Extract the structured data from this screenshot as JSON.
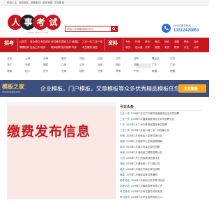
{
  "topbar": {
    "links": [
      "职场人生",
      "在线报名",
      "资格考试",
      "宣传专题",
      "学历教育"
    ]
  },
  "header": {
    "logo_text": "人事考试",
    "logo_domain": "WWW.EDATA.COM",
    "search_placeholder": "请输入你想要搜索的考试",
    "phone_label": "24小时服务热线",
    "phone_number": "13312420851",
    "brand_color": "#c8161e",
    "accent_color": "#2e6fd0"
  },
  "nav": {
    "section_1": "招考",
    "section_2": "资料",
    "group_1_row_1": [
      "公务员",
      "事业单位",
      "考试资讯",
      "考试教育",
      "国家人才",
      "选调生",
      "三支一扶",
      "三支一扶"
    ],
    "group_1_row_2": [
      "警察招考",
      "社会工作",
      "培训",
      "教师招聘",
      "医疗招聘",
      "专家",
      "考生服务",
      "报名"
    ],
    "group_2_row_1": [
      "专业",
      "行测",
      "申论",
      "面试",
      "综合",
      "金融",
      "职业",
      "会计"
    ],
    "group_2_row_2": [
      "学历",
      "四六级",
      "升学",
      "英语",
      "考试",
      "教育",
      "行业",
      "公考"
    ]
  },
  "regions": {
    "row_1": [
      "北京",
      "上海",
      "天津",
      "重庆",
      "河北",
      "山西",
      "辽宁",
      "吉林",
      "黑龙江",
      "江苏"
    ],
    "row_2": [
      "浙江",
      "安徽",
      "福建",
      "江西",
      "山东",
      "河南",
      "湖北",
      "湖南",
      "广东",
      "广西"
    ],
    "row_3": [
      "海南",
      "四川",
      "贵州",
      "云南",
      "陕西",
      "甘肃",
      "青海",
      "宁夏",
      "新疆",
      "西藏"
    ]
  },
  "banner": {
    "brand": "模板之家",
    "domain": "mubanzhijia.com",
    "slogan": "企业模板，门户模板，文章模板等众多优秀精品模板任您挑选！",
    "badge": "天天模板"
  },
  "hero": {
    "notice_text": "缴费发布信息"
  },
  "today": {
    "title": "今日头条",
    "items": [
      {
        "tag": "三支一扶",
        "text": "2025年7月辽宁兴城市高速服务区业务员招聘"
      },
      {
        "tag": "三支一扶",
        "text": "2025年7月福建省服务区业务员招聘公告"
      },
      {
        "tag": "广州",
        "text": "2025年7月广州市教育局直属单位招聘"
      },
      {
        "tag": "三支一扶",
        "text": "2025年7月四川省三支一扶招募公告"
      },
      {
        "tag": "安徽",
        "text": "2025年7月安徽省人事考试院公告"
      },
      {
        "tag": "成都",
        "text": "2025年7月成都市公安局招聘辅警"
      },
      {
        "tag": "南京",
        "text": "2025年7月南京市事业单位招聘"
      },
      {
        "tag": "海南",
        "text": "2025年7月海南省卫健委招聘公告"
      },
      {
        "tag": "江西",
        "text": "2025年7月江西省教师资格认定"
      },
      {
        "tag": "湖南",
        "text": "2025年7月湖南省人才引进公告"
      },
      {
        "tag": "重庆",
        "text": "2025年7月重庆市事业单位招聘"
      },
      {
        "tag": "福建",
        "text": "2025年7月福建省考试院通知"
      },
      {
        "tag": "招考动态",
        "text": "2025年7月各地公务员考试动态"
      },
      {
        "tag": "招考动态",
        "text": "2025年7月最新招考信息汇总"
      },
      {
        "tag": "考试资讯",
        "text": "2025年7月考试报名时间安排"
      },
      {
        "tag": "考试资讯",
        "text": "2025年7月考试成绩查询入口"
      }
    ]
  }
}
